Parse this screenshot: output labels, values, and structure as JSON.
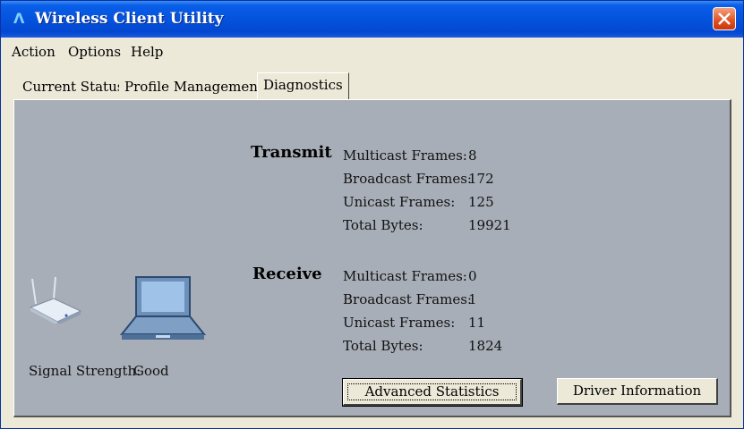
{
  "window": {
    "title": "Wireless Client Utility",
    "close_icon": "close-icon"
  },
  "menu": [
    {
      "label": "Action"
    },
    {
      "label": "Options"
    },
    {
      "label": "Help"
    }
  ],
  "tabs": [
    {
      "label": "Current Status",
      "active": false
    },
    {
      "label": "Profile Management",
      "active": false
    },
    {
      "label": "Diagnostics",
      "active": true
    }
  ],
  "transmit": {
    "title": "Transmit",
    "rows": [
      {
        "label": "Multicast Frames:",
        "value": "8"
      },
      {
        "label": "Broadcast Frames:",
        "value": "172"
      },
      {
        "label": "Unicast Frames:",
        "value": "125"
      },
      {
        "label": "Total Bytes:",
        "value": "19921"
      }
    ]
  },
  "receive": {
    "title": "Receive",
    "rows": [
      {
        "label": "Multicast Frames:",
        "value": "0"
      },
      {
        "label": "Broadcast Frames:",
        "value": "1"
      },
      {
        "label": "Unicast Frames:",
        "value": "11"
      },
      {
        "label": "Total Bytes:",
        "value": "1824"
      }
    ]
  },
  "signal": {
    "label": "Signal Strength:",
    "value": "Good"
  },
  "buttons": {
    "advanced_statistics": "Advanced Statistics",
    "driver_information": "Driver Information"
  },
  "colors": {
    "title_bar": "#0453dd",
    "panel": "#a8aeb7",
    "window": "#ece9d8"
  }
}
